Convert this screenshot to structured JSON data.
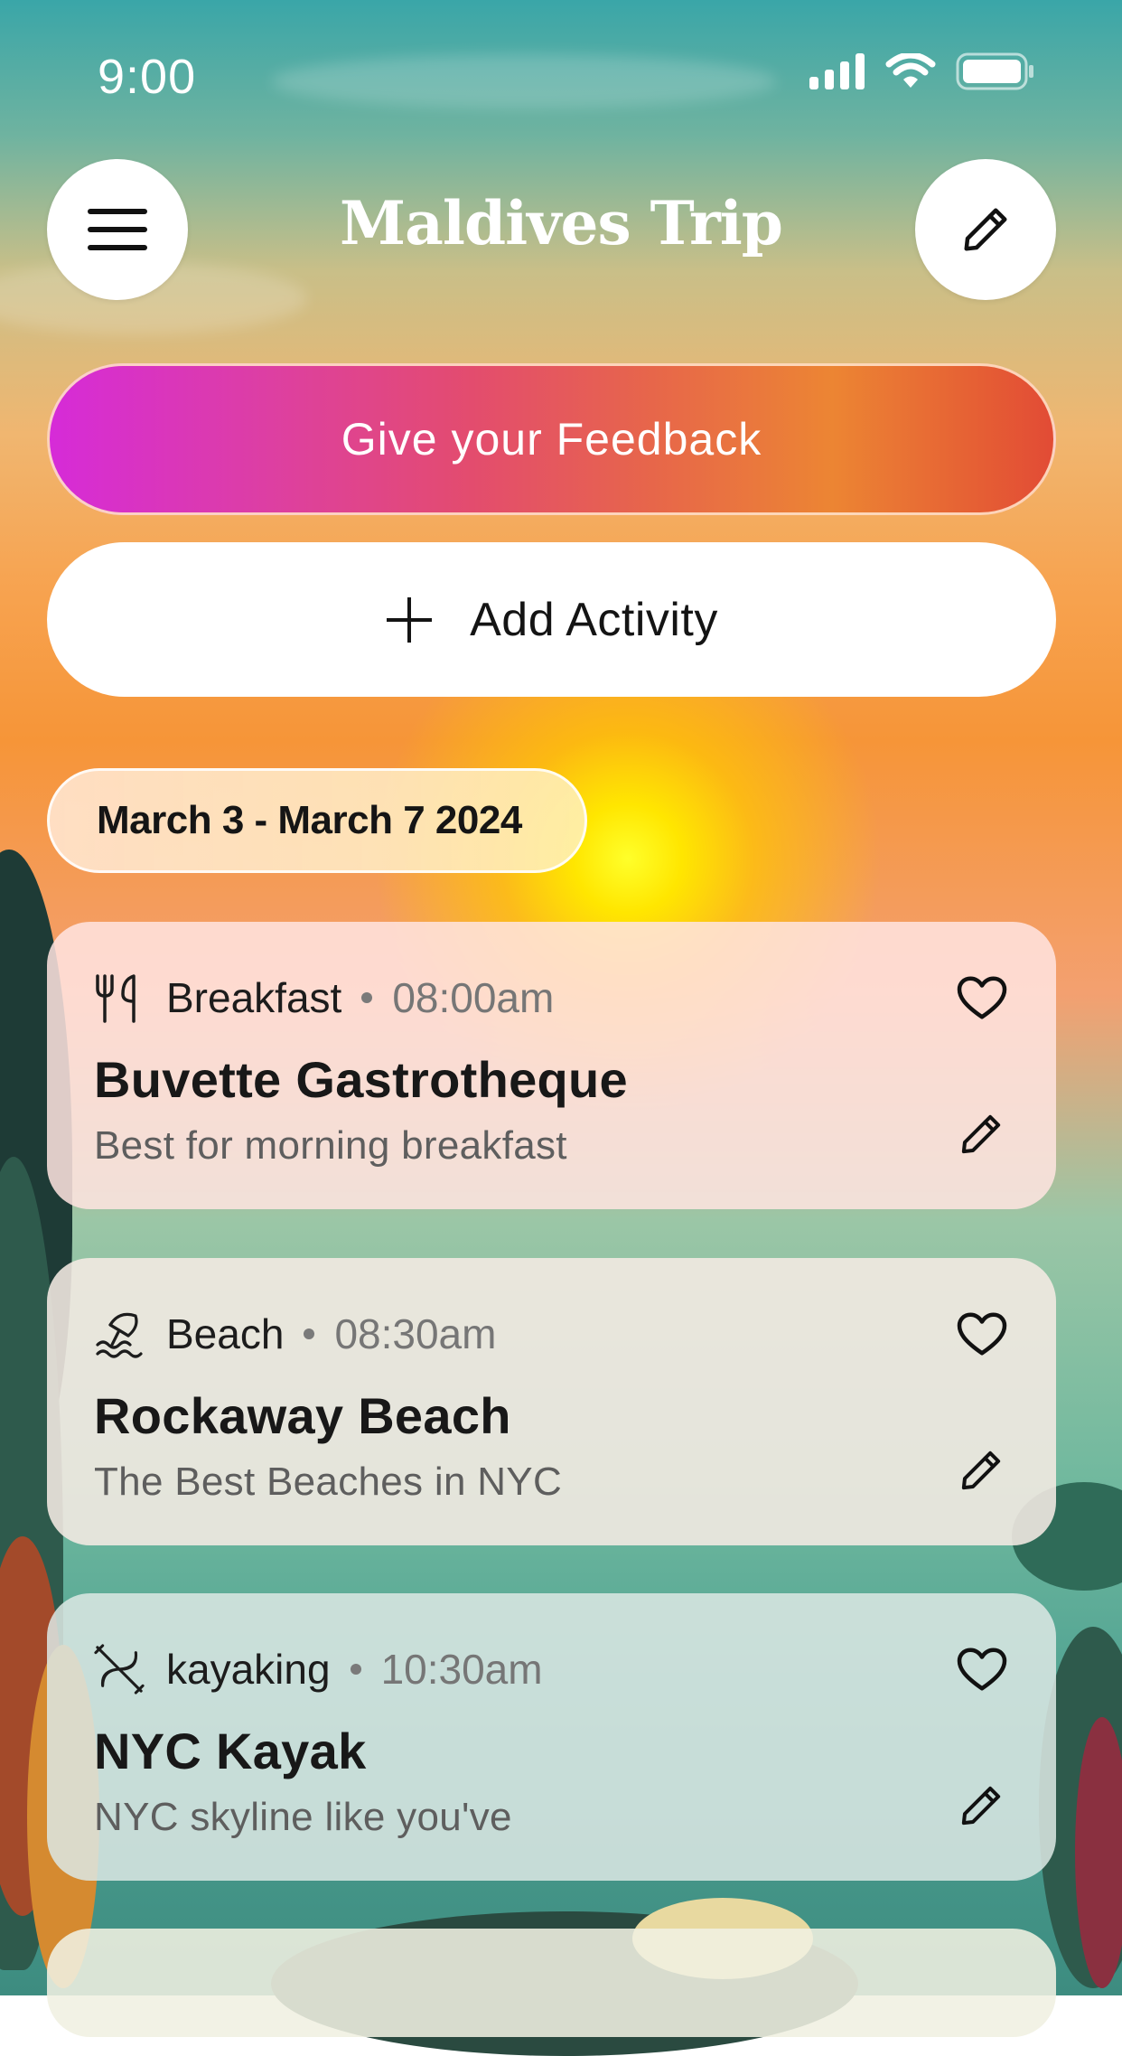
{
  "status_bar": {
    "time": "9:00"
  },
  "header": {
    "title": "Maldives Trip",
    "menu_icon": "hamburger-menu-icon",
    "edit_icon": "pencil-icon"
  },
  "actions": {
    "feedback_label": "Give your Feedback",
    "add_activity_label": "Add Activity",
    "add_icon": "plus-icon"
  },
  "date_range": "March 3 - March 7 2024",
  "activities": [
    {
      "category": "Breakfast",
      "category_icon": "fork-knife-icon",
      "time": "08:00am",
      "title": "Buvette Gastrotheque",
      "subtitle": "Best for morning breakfast"
    },
    {
      "category": "Beach",
      "category_icon": "beach-umbrella-icon",
      "time": "08:30am",
      "title": "Rockaway Beach",
      "subtitle": "The Best Beaches in NYC"
    },
    {
      "category": "kayaking",
      "category_icon": "kayak-icon",
      "time": "10:30am",
      "title": "NYC Kayak",
      "subtitle": "NYC skyline like you've"
    }
  ],
  "colors": {
    "feedback_gradient_start": "#d62bd8",
    "feedback_gradient_end": "#e24b35"
  }
}
